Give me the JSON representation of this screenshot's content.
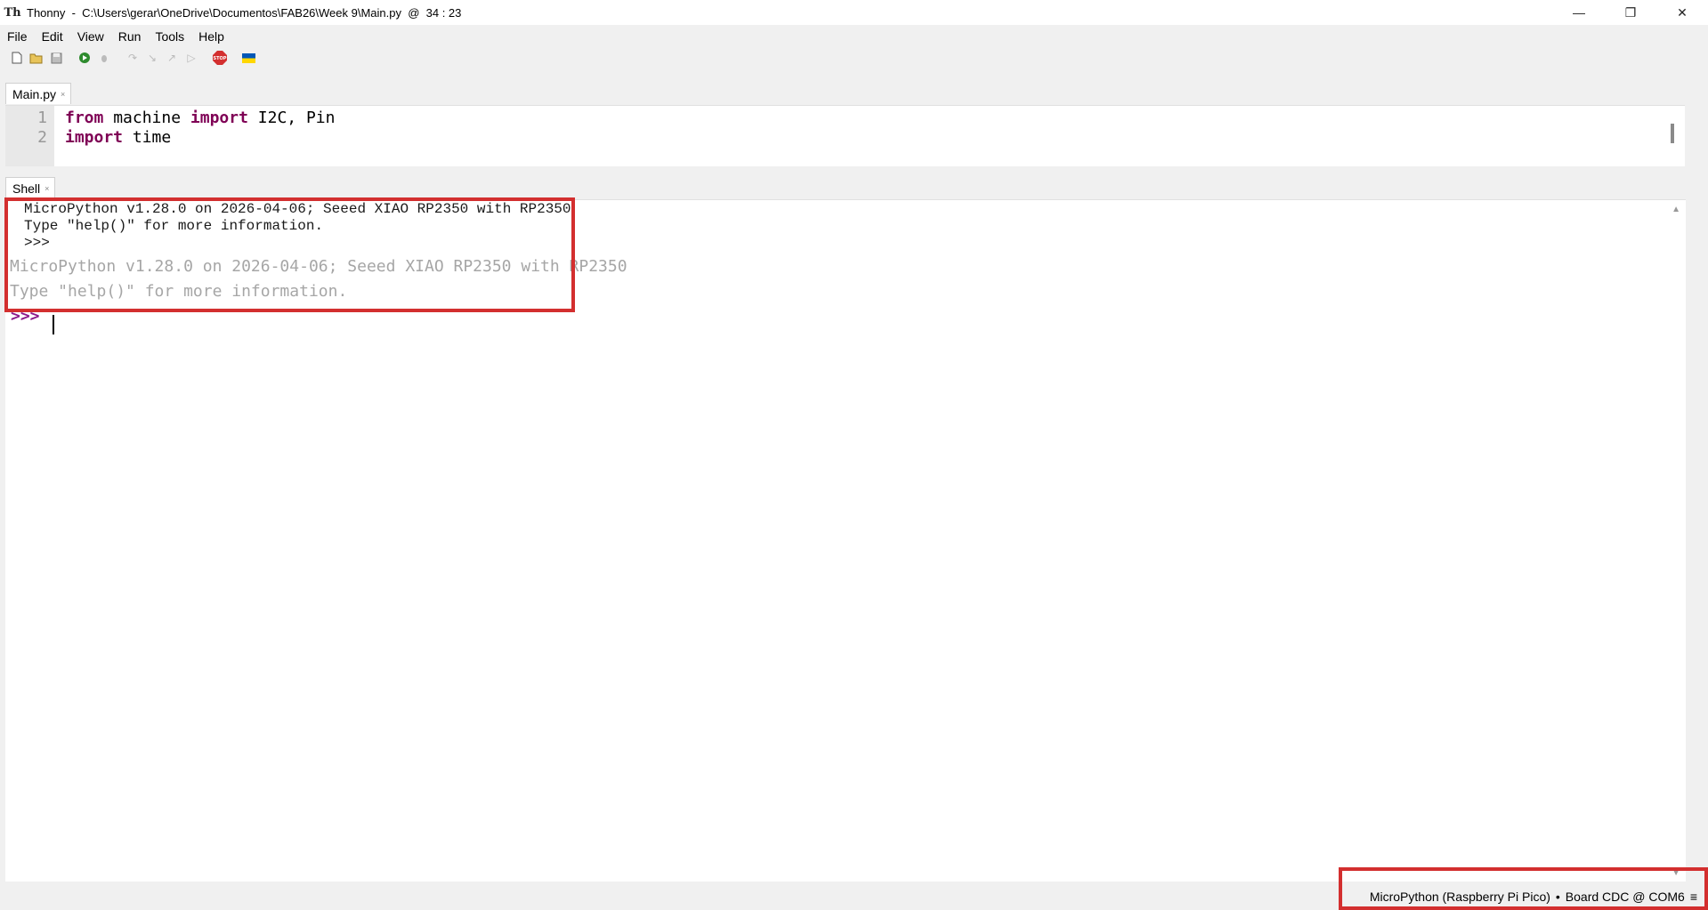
{
  "window": {
    "app_name": "Thonny",
    "title": "Thonny  -  C:\\Users\\gerar\\OneDrive\\Documentos\\FAB26\\Week 9\\Main.py  @  34 : 23",
    "controls": {
      "minimize": "—",
      "restore": "❐",
      "close": "✕"
    }
  },
  "menu": [
    "File",
    "Edit",
    "View",
    "Run",
    "Tools",
    "Help"
  ],
  "toolbar": {
    "buttons": [
      {
        "name": "new-file-icon",
        "glyph": "🗋"
      },
      {
        "name": "open-file-icon",
        "glyph": "📂"
      },
      {
        "name": "save-file-icon",
        "glyph": "💾"
      },
      {
        "name": "run-icon",
        "glyph": "▶"
      },
      {
        "name": "debug-icon",
        "glyph": "🐞"
      },
      {
        "name": "step-over-icon",
        "glyph": "↷"
      },
      {
        "name": "step-into-icon",
        "glyph": "↘"
      },
      {
        "name": "step-out-icon",
        "glyph": "↗"
      },
      {
        "name": "resume-icon",
        "glyph": "▷"
      },
      {
        "name": "stop-icon",
        "glyph": "STOP"
      },
      {
        "name": "ukraine-flag-icon",
        "glyph": ""
      }
    ],
    "colors": {
      "run": "#2e8b2e",
      "stop": "#d32f2f",
      "flag_top": "#0057b7",
      "flag_bottom": "#ffd700"
    }
  },
  "editor": {
    "tab_label": "Main.py",
    "tab_close": "×",
    "lines": [
      {
        "num": "1",
        "kw1": "from",
        "mid": " machine ",
        "kw2": "import",
        "rest": " I2C, Pin"
      },
      {
        "num": "2",
        "kw1": "import",
        "mid": " time",
        "kw2": "",
        "rest": ""
      }
    ]
  },
  "shell": {
    "tab_label": "Shell",
    "tab_close": "×",
    "old_output": [
      "MicroPython v1.28.0 on 2026-04-06; Seeed XIAO RP2350 with RP2350",
      "Type \"help()\" for more information.",
      ">>>"
    ],
    "banner": [
      "MicroPython v1.28.0 on 2026-04-06; Seeed XIAO RP2350 with RP2350",
      "Type \"help()\" for more information."
    ],
    "prompt": ">>>"
  },
  "status": {
    "interpreter": "MicroPython (Raspberry Pi Pico)",
    "separator": "•",
    "port": "Board CDC @ COM6",
    "menu_glyph": "≡"
  },
  "colors": {
    "highlight": "#d32f2f",
    "keyword": "#7f0055",
    "prompt": "#8b1a8b"
  }
}
